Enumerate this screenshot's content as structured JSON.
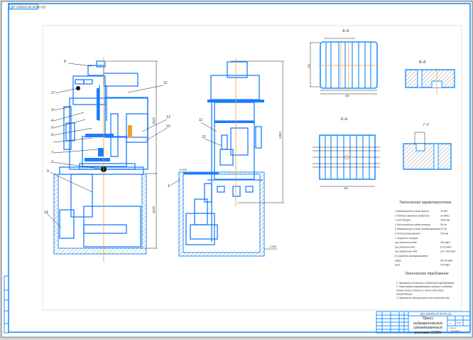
{
  "colors": {
    "frame": "#1e90ff",
    "line": "#1a7cff",
    "axis": "#f0a030",
    "dim": "#222222",
    "paper": "#ffffff"
  },
  "stamp": "ДП.150503.00.00.00 СБ",
  "views": {
    "section_aa": "А–А",
    "section_bb": "Б–Б",
    "section_vv": "В–В",
    "section_gg": "Г–Г",
    "front_height": "4020",
    "front_lower": "3100",
    "side_height": "5300",
    "side_level_top": "0.000",
    "side_level_bottom": "-3.000",
    "aa_width": "980",
    "aa_height": "620",
    "bb_width": "980"
  },
  "callouts": [
    "8",
    "17",
    "3",
    "4",
    "5",
    "6",
    "7",
    "2",
    "9",
    "1",
    "14",
    "11",
    "12",
    "13",
    "10",
    "15"
  ],
  "tech_char": {
    "title": "Техническая характеристика",
    "items": [
      {
        "label": "1 Номинальное усилие пресса",
        "value": "16 МН"
      },
      {
        "label": "2 Рабочее давление жидкости",
        "value": "32 МПа"
      },
      {
        "label": "3 Ход ползуна",
        "value": "1000 мм"
      },
      {
        "label": "4 Число рабочих ходов ползуна",
        "value": "28 х/ч"
      },
      {
        "label": "5 Номинальное усилие выталкивателя",
        "value": "32 х/ч"
      },
      {
        "label": "6 Ход выталкивателя",
        "value": "260 мм"
      },
      {
        "label": "7 Скорость ползуна",
        "value": ""
      },
      {
        "label": "   при холостом ходе",
        "value": "200 мм/с"
      },
      {
        "label": "   при рабочем ходе",
        "value": "8–26 мм/с"
      },
      {
        "label": "   при обратном ходе",
        "value": "127–140 мм/с"
      },
      {
        "label": "8 Скорость выталкивателя",
        "value": ""
      },
      {
        "label": "   вверх",
        "value": "65–26 мм/с"
      },
      {
        "label": "   вниз",
        "value": "270 мм/с"
      }
    ]
  },
  "tech_req": {
    "title": "Технические требования",
    "items": [
      "1. Проверить плотность соединений трубопроводов.",
      "2. Зазор между направляющими ползуна и стойками",
      "должен быть не более 0,1 мм по всей длине",
      "направляющих.",
      "3. Произвести обкатку пресса на холостом ходу."
    ]
  },
  "title_block": {
    "code": "ДП.150503.00.00.00 СБ",
    "name": "Пресс гидравлический штамповочный усилием 16МН",
    "scale": "1:20",
    "mass": "—",
    "sheet": "Лист 1",
    "group": "ИЗ-08-2"
  }
}
